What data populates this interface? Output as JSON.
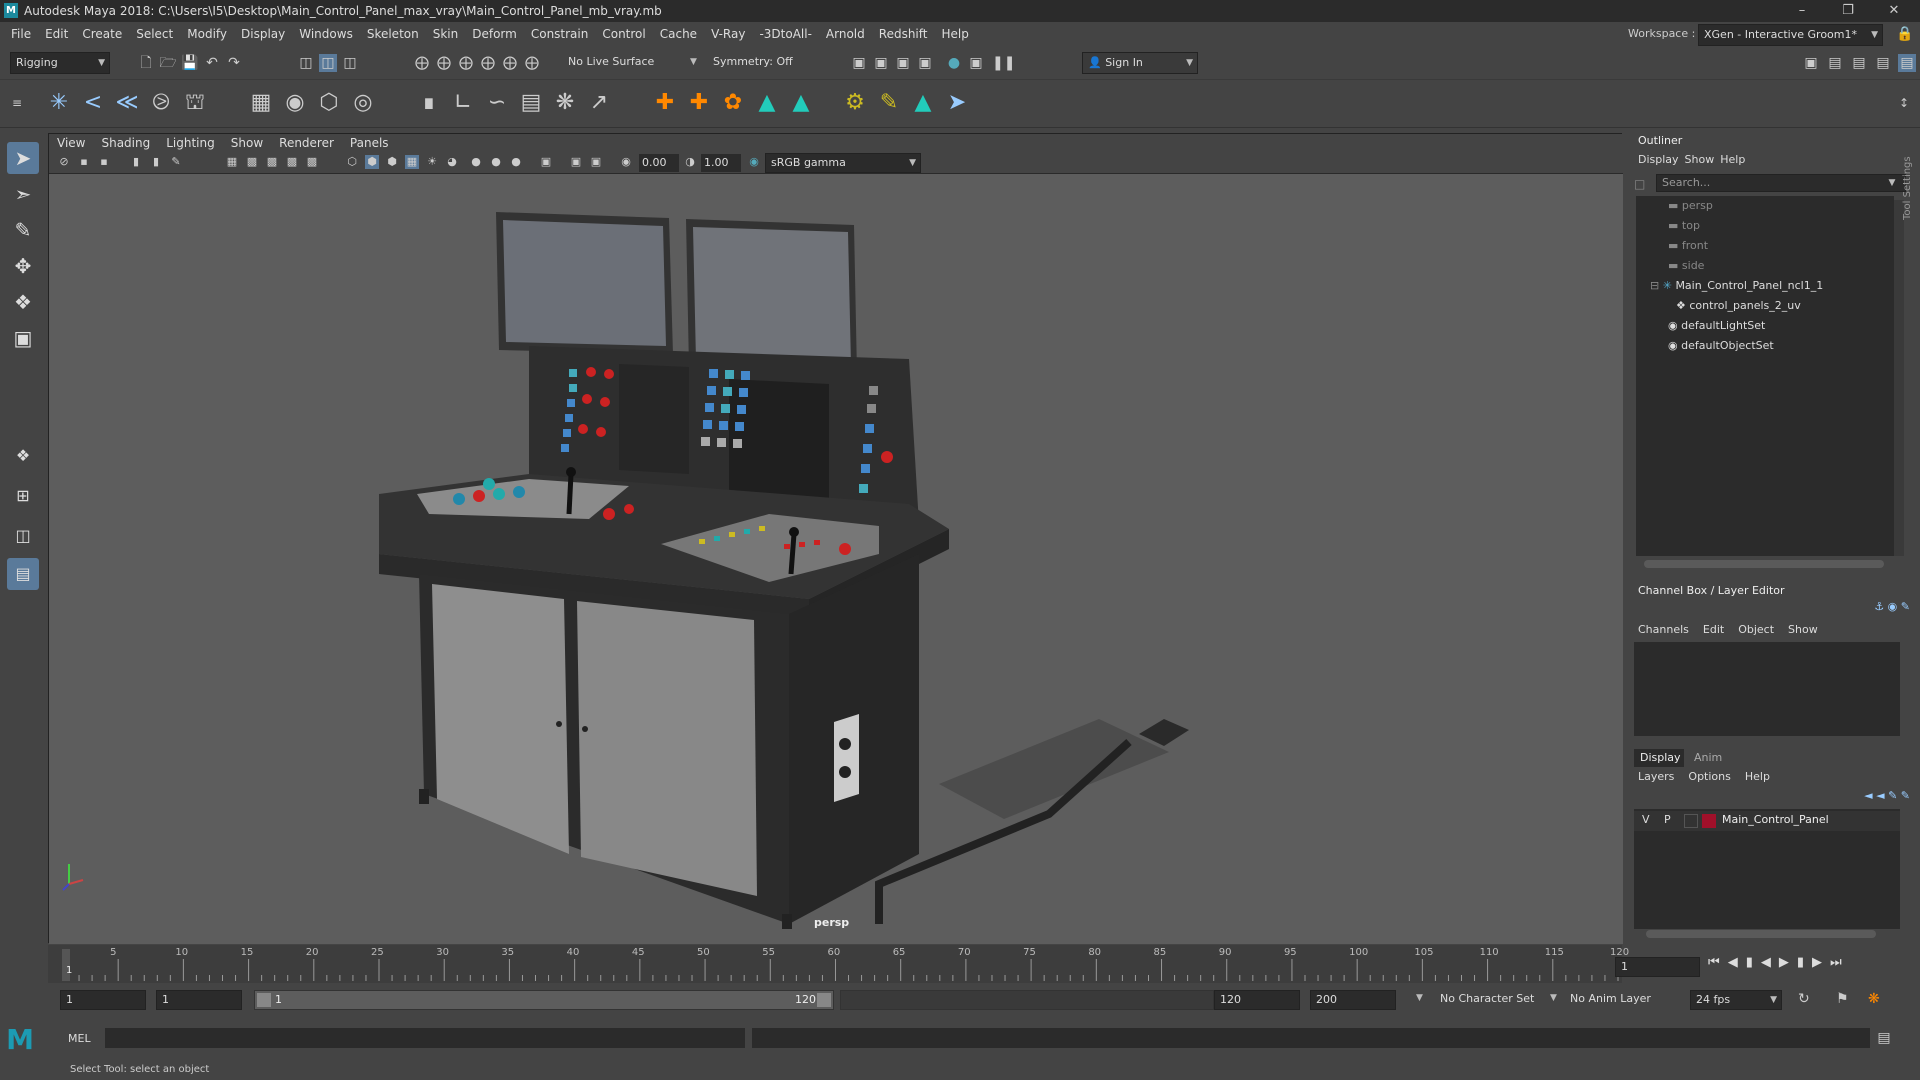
{
  "window": {
    "title": "Autodesk Maya 2018: C:\\Users\\I5\\Desktop\\Main_Control_Panel_max_vray\\Main_Control_Panel_mb_vray.mb",
    "workspace_label": "Workspace :",
    "workspace_value": "XGen - Interactive Groom1*"
  },
  "menus": [
    "File",
    "Edit",
    "Create",
    "Select",
    "Modify",
    "Display",
    "Windows",
    "Skeleton",
    "Skin",
    "Deform",
    "Constrain",
    "Control",
    "Cache",
    "V-Ray",
    "-3DtoAll-",
    "Arnold",
    "Redshift",
    "Help"
  ],
  "status_line": {
    "menu_set": "Rigging",
    "live_surface": "No Live Surface",
    "symmetry": "Symmetry: Off",
    "sign_in": "Sign In"
  },
  "viewport": {
    "menus": [
      "View",
      "Shading",
      "Lighting",
      "Show",
      "Renderer",
      "Panels"
    ],
    "exposure": "0.00",
    "gamma": "1.00",
    "color_space": "sRGB gamma",
    "camera_label": "persp"
  },
  "outliner": {
    "title": "Outliner",
    "menus": [
      "Display",
      "Show",
      "Help"
    ],
    "search_placeholder": "Search...",
    "items": [
      {
        "label": "persp",
        "dim": true
      },
      {
        "label": "top",
        "dim": true
      },
      {
        "label": "front",
        "dim": true
      },
      {
        "label": "side",
        "dim": true
      },
      {
        "label": "Main_Control_Panel_ncl1_1",
        "dim": false
      },
      {
        "label": "control_panels_2_uv",
        "dim": false
      },
      {
        "label": "defaultLightSet",
        "dim": false
      },
      {
        "label": "defaultObjectSet",
        "dim": false
      }
    ]
  },
  "channel_box": {
    "title": "Channel Box / Layer Editor",
    "menus": [
      "Channels",
      "Edit",
      "Object",
      "Show"
    ]
  },
  "layer_editor": {
    "tabs": [
      "Display",
      "Anim"
    ],
    "menus": [
      "Layers",
      "Options",
      "Help"
    ],
    "layer": {
      "v": "V",
      "p": "P",
      "name": "Main_Control_Panel",
      "color": "#a0102a"
    }
  },
  "timeline": {
    "ticks": [
      "5",
      "10",
      "15",
      "20",
      "25",
      "30",
      "35",
      "40",
      "45",
      "50",
      "55",
      "60",
      "65",
      "70",
      "75",
      "80",
      "85",
      "90",
      "95",
      "100",
      "105",
      "110",
      "115",
      "120"
    ],
    "current_frame": "1",
    "current_marker": "1"
  },
  "range": {
    "start": "1",
    "start_inner": "1",
    "slider_start": "1",
    "slider_end": "120",
    "end_inner": "120",
    "end": "200",
    "character_set": "No Character Set",
    "anim_layer": "No Anim Layer",
    "fps": "24 fps"
  },
  "command_line": {
    "label": "MEL"
  },
  "status_message": "Select Tool: select an object",
  "side_tab": "Tool Settings"
}
